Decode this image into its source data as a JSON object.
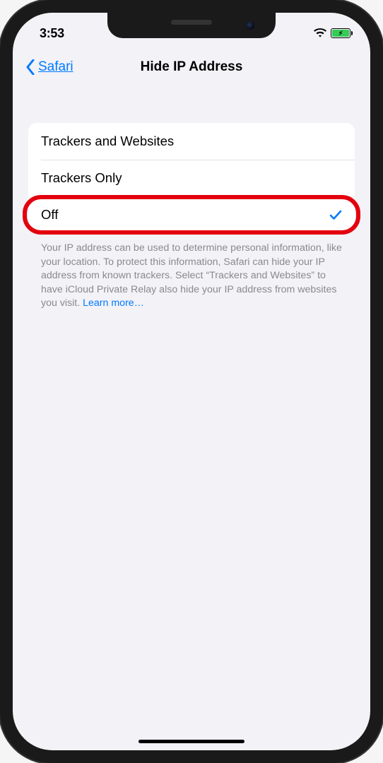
{
  "status_bar": {
    "time": "3:53"
  },
  "nav": {
    "back_label": "Safari",
    "title": "Hide IP Address"
  },
  "options": [
    {
      "label": "Trackers and Websites",
      "selected": false
    },
    {
      "label": "Trackers Only",
      "selected": false
    },
    {
      "label": "Off",
      "selected": true
    }
  ],
  "footer": {
    "text": "Your IP address can be used to determine personal information, like your location. To protect this information, Safari can hide your IP address from known trackers. Select “Trackers and Websites” to have iCloud Private Relay also hide your IP address from websites you visit. ",
    "link_label": "Learn more…"
  }
}
